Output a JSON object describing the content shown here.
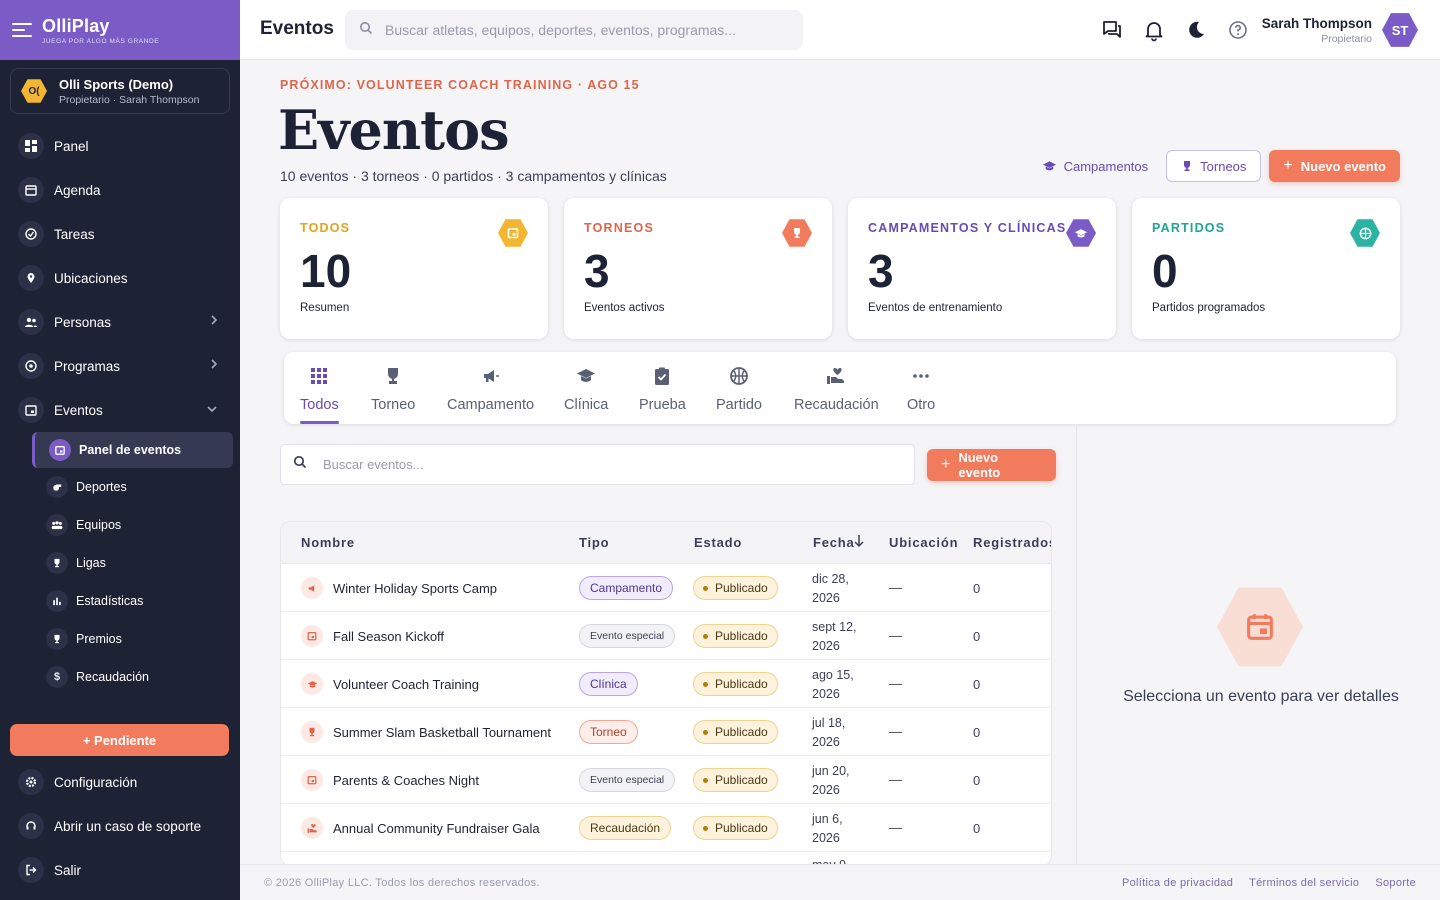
{
  "brand": {
    "name": "OlliPlay",
    "tagline": "JUEGA POR ALGO MÁS GRANDE",
    "accent": "#7b5cc6",
    "sidebar_bg": "#1e2235"
  },
  "org": {
    "logo": "O(",
    "name": "Olli Sports (Demo)",
    "subtitle": "Propietario · Sarah Thompson"
  },
  "nav": [
    {
      "label": "Panel",
      "icon": "dashboard-icon"
    },
    {
      "label": "Agenda",
      "icon": "calendar-icon"
    },
    {
      "label": "Tareas",
      "icon": "check-circle-icon"
    },
    {
      "label": "Ubicaciones",
      "icon": "location-pin-icon"
    },
    {
      "label": "Personas",
      "icon": "people-icon",
      "chevron": "›"
    },
    {
      "label": "Programas",
      "icon": "ball-icon",
      "chevron": "›"
    },
    {
      "label": "Eventos",
      "icon": "event-icon",
      "chevron": "⌄"
    }
  ],
  "events_subnav": [
    {
      "label": "Panel de eventos",
      "icon": "event-icon"
    },
    {
      "label": "Deportes",
      "icon": "whistle-icon"
    },
    {
      "label": "Equipos",
      "icon": "group-icon"
    },
    {
      "label": "Ligas",
      "icon": "trophy-icon"
    },
    {
      "label": "Estadísticas",
      "icon": "bar-chart-icon"
    },
    {
      "label": "Premios",
      "icon": "trophy-icon"
    },
    {
      "label": "Recaudación",
      "icon": "dollar-icon"
    }
  ],
  "pending_button": "+  Pendiente",
  "bottom_nav": [
    {
      "label": "Configuración",
      "icon": "gear-icon"
    },
    {
      "label": "Abrir un caso de soporte",
      "icon": "support-icon"
    },
    {
      "label": "Salir",
      "icon": "logout-icon"
    }
  ],
  "topbar": {
    "title": "Eventos",
    "search_placeholder": "Buscar atletas, equipos, deportes, eventos, programas...",
    "user_name": "Sarah Thompson",
    "user_role": "Propietario",
    "user_initials": "ST"
  },
  "header": {
    "eyebrow": "PRÓXIMO: VOLUNTEER COACH TRAINING · AGO 15",
    "title": "Eventos",
    "summary": "10 eventos · 3 torneos · 0 partidos · 3 campamentos y clínicas",
    "btn_camps": "Campamentos",
    "btn_tournaments": "Torneos",
    "btn_new": "Nuevo evento"
  },
  "stats": [
    {
      "label": "TODOS",
      "value": "10",
      "desc": "Resumen",
      "color": "#e3a21a",
      "icon": "calendar-icon"
    },
    {
      "label": "TORNEOS",
      "value": "3",
      "desc": "Eventos activos",
      "color": "#e0654a",
      "icon": "trophy-icon"
    },
    {
      "label": "CAMPAMENTOS Y CLÍNICAS",
      "value": "3",
      "desc": "Eventos de entrenamiento",
      "color": "#6a4bb5",
      "icon": "graduation-cap-icon"
    },
    {
      "label": "PARTIDOS",
      "value": "0",
      "desc": "Partidos programados",
      "color": "#1fa596",
      "icon": "basketball-icon"
    }
  ],
  "tabs": [
    {
      "label": "Todos",
      "icon": "grid-icon"
    },
    {
      "label": "Torneo",
      "icon": "trophy-icon"
    },
    {
      "label": "Campamento",
      "icon": "megaphone-icon"
    },
    {
      "label": "Clínica",
      "icon": "graduation-cap-icon"
    },
    {
      "label": "Prueba",
      "icon": "clipboard-check-icon"
    },
    {
      "label": "Partido",
      "icon": "basketball-icon"
    },
    {
      "label": "Recaudación",
      "icon": "donation-icon"
    },
    {
      "label": "Otro",
      "icon": "more-icon"
    }
  ],
  "event_search_placeholder": "Buscar eventos...",
  "new_event_small": "Nuevo evento",
  "table": {
    "columns": [
      "Nombre",
      "Tipo",
      "Estado",
      "Fecha",
      "Ubicación",
      "Registrados"
    ],
    "rows": [
      {
        "name": "Winter Holiday Sports Camp",
        "type": "Campamento",
        "status": "Publicado",
        "date": "dic 28, 2026",
        "location": "—",
        "registered": "0",
        "icon": "megaphone-icon"
      },
      {
        "name": "Fall Season Kickoff",
        "type": "Evento especial",
        "status": "Publicado",
        "date": "sept 12, 2026",
        "location": "—",
        "registered": "0",
        "icon": "calendar-icon"
      },
      {
        "name": "Volunteer Coach Training",
        "type": "Clínica",
        "status": "Publicado",
        "date": "ago 15, 2026",
        "location": "—",
        "registered": "0",
        "icon": "graduation-cap-icon"
      },
      {
        "name": "Summer Slam Basketball Tournament",
        "type": "Torneo",
        "status": "Publicado",
        "date": "jul 18, 2026",
        "location": "—",
        "registered": "0",
        "icon": "trophy-icon"
      },
      {
        "name": "Parents & Coaches Night",
        "type": "Evento especial",
        "status": "Publicado",
        "date": "jun 20, 2026",
        "location": "—",
        "registered": "0",
        "icon": "calendar-icon"
      },
      {
        "name": "Annual Community Fundraiser Gala",
        "type": "Recaudación",
        "status": "Publicado",
        "date": "jun 6, 2026",
        "location": "—",
        "registered": "0",
        "icon": "donation-icon"
      },
      {
        "name": "",
        "type": "",
        "status": "",
        "date": "may 9,",
        "location": "",
        "registered": "",
        "icon": ""
      }
    ]
  },
  "empty_state": "Selecciona un evento para ver detalles",
  "footer": {
    "copyright": "© 2026 OlliPlay LLC. Todos los derechos reservados.",
    "links": [
      "Política de privacidad",
      "Términos del servicio",
      "Soporte"
    ]
  }
}
